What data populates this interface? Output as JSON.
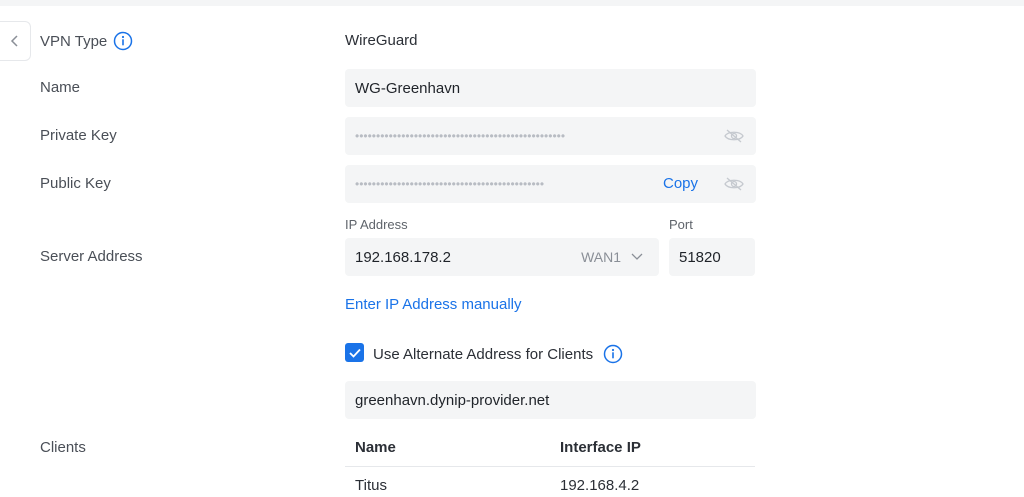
{
  "form": {
    "vpn_type": {
      "label": "VPN Type",
      "value": "WireGuard"
    },
    "name": {
      "label": "Name",
      "value": "WG-Greenhavn"
    },
    "private_key": {
      "label": "Private Key",
      "masked": "••••••••••••••••••••••••••••••••••••••••••••••••••"
    },
    "public_key": {
      "label": "Public Key",
      "masked": "•••••••••••••••••••••••••••••••••••••••••••••",
      "copy_label": "Copy"
    },
    "server_address": {
      "label": "Server Address",
      "ip_label": "IP Address",
      "ip_value": "192.168.178.2",
      "interface": "WAN1",
      "port_label": "Port",
      "port_value": "51820",
      "manual_link": "Enter IP Address manually"
    },
    "alternate": {
      "checkbox_label": "Use Alternate Address for Clients",
      "checked": true,
      "value": "greenhavn.dynip-provider.net"
    },
    "clients": {
      "label": "Clients",
      "columns": [
        "Name",
        "Interface IP"
      ],
      "rows": [
        {
          "name": "Titus",
          "ip": "192.168.4.2"
        }
      ]
    }
  },
  "colors": {
    "accent": "#1a73e8",
    "field_bg": "#f4f5f6"
  }
}
